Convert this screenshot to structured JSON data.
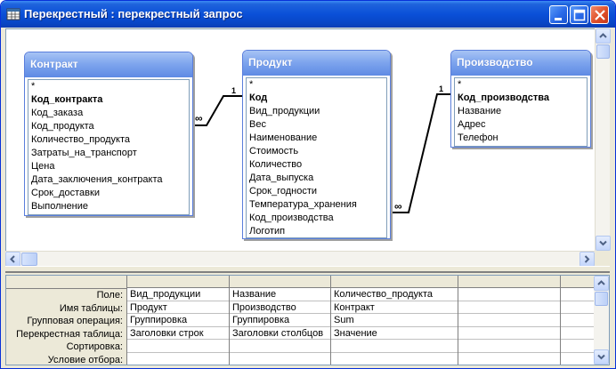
{
  "window": {
    "title": "Перекрестный : перекрестный запрос"
  },
  "tables": [
    {
      "name": "Контракт",
      "fields": [
        {
          "label": "*",
          "key": false
        },
        {
          "label": "Код_контракта",
          "key": true
        },
        {
          "label": "Код_заказа",
          "key": false
        },
        {
          "label": "Код_продукта",
          "key": false
        },
        {
          "label": "Количество_продукта",
          "key": false
        },
        {
          "label": "Затраты_на_транспорт",
          "key": false
        },
        {
          "label": "Цена",
          "key": false
        },
        {
          "label": "Дата_заключения_контракта",
          "key": false
        },
        {
          "label": "Срок_доставки",
          "key": false
        },
        {
          "label": "Выполнение",
          "key": false
        }
      ]
    },
    {
      "name": "Продукт",
      "fields": [
        {
          "label": "*",
          "key": false
        },
        {
          "label": "Код",
          "key": true
        },
        {
          "label": "Вид_продукции",
          "key": false
        },
        {
          "label": "Вес",
          "key": false
        },
        {
          "label": "Наименование",
          "key": false
        },
        {
          "label": "Стоимость",
          "key": false
        },
        {
          "label": "Количество",
          "key": false
        },
        {
          "label": "Дата_выпуска",
          "key": false
        },
        {
          "label": "Срок_годности",
          "key": false
        },
        {
          "label": "Температура_хранения",
          "key": false
        },
        {
          "label": "Код_производства",
          "key": false
        },
        {
          "label": "Логотип",
          "key": false
        }
      ]
    },
    {
      "name": "Производство",
      "fields": [
        {
          "label": "*",
          "key": false
        },
        {
          "label": "Код_производства",
          "key": true
        },
        {
          "label": "Название",
          "key": false
        },
        {
          "label": "Адрес",
          "key": false
        },
        {
          "label": "Телефон",
          "key": false
        }
      ]
    }
  ],
  "relations": [
    {
      "one_label": "1",
      "many_label": "∞"
    },
    {
      "one_label": "1",
      "many_label": "∞"
    }
  ],
  "grid": {
    "row_labels": [
      "Поле:",
      "Имя таблицы:",
      "Групповая операция:",
      "Перекрестная таблица:",
      "Сортировка:",
      "Условие отбора:"
    ],
    "columns": [
      {
        "cells": [
          "Вид_продукции",
          "Продукт",
          "Группировка",
          "Заголовки строк",
          "",
          ""
        ]
      },
      {
        "cells": [
          "Название",
          "Производство",
          "Группировка",
          "Заголовки столбцов",
          "",
          ""
        ]
      },
      {
        "cells": [
          "Количество_продукта",
          "Контракт",
          "Sum",
          "Значение",
          "",
          ""
        ]
      },
      {
        "cells": [
          "",
          "",
          "",
          "",
          "",
          ""
        ]
      },
      {
        "cells": [
          "",
          "",
          "",
          "",
          "",
          ""
        ]
      }
    ]
  },
  "icons": {
    "window": "datasheet-window-icon",
    "minimize": "minimize-icon",
    "maximize": "maximize-icon",
    "close": "close-icon"
  }
}
